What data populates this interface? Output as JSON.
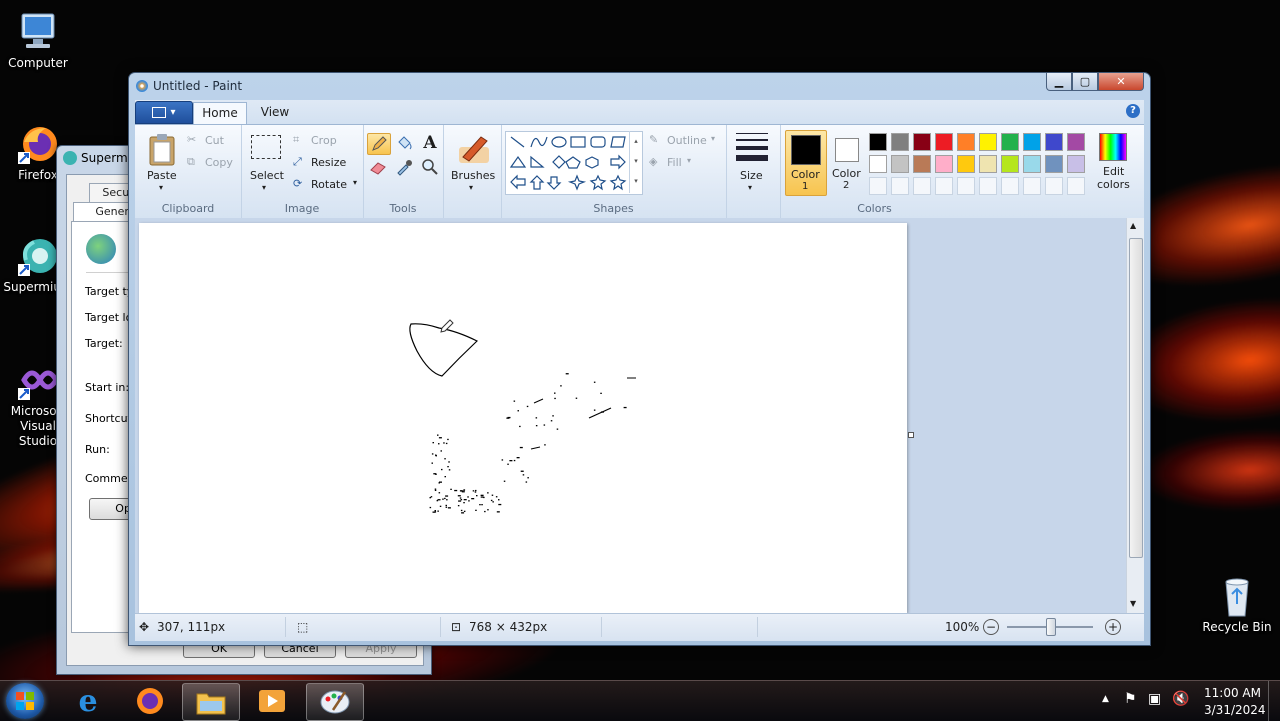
{
  "desktop": {
    "icons": [
      {
        "label": "Computer"
      },
      {
        "label": "Firefox"
      },
      {
        "label": "Supermium"
      },
      {
        "label": "Microsoft Visual Studio"
      },
      {
        "label": "Recycle Bin"
      }
    ]
  },
  "properties_dialog": {
    "title": "Supermium",
    "tabs": [
      "Security",
      "General"
    ],
    "fields": [
      "Target type:",
      "Target location:",
      "Target:",
      "Start in:",
      "Shortcut key:",
      "Run:",
      "Comment:"
    ],
    "open_button": "Open",
    "buttons": {
      "ok": "OK",
      "cancel": "Cancel",
      "apply": "Apply"
    }
  },
  "paint": {
    "title": "Untitled - Paint",
    "tabs": {
      "home": "Home",
      "view": "View"
    },
    "clipboard": {
      "label": "Clipboard",
      "paste": "Paste",
      "cut": "Cut",
      "copy": "Copy"
    },
    "image": {
      "label": "Image",
      "select": "Select",
      "crop": "Crop",
      "resize": "Resize",
      "rotate": "Rotate"
    },
    "tools": {
      "label": "Tools"
    },
    "brushes": {
      "label": "Brushes"
    },
    "shapes": {
      "label": "Shapes",
      "outline": "Outline",
      "fill": "Fill"
    },
    "size": {
      "label": "Size"
    },
    "color1": {
      "label": "Color",
      "num": "1",
      "value": "#000000"
    },
    "color2": {
      "label": "Color",
      "num": "2",
      "value": "#ffffff"
    },
    "colors": {
      "label": "Colors",
      "edit_label1": "Edit",
      "edit_label2": "colors",
      "row1": [
        "#000000",
        "#7f7f7f",
        "#880015",
        "#ed1c24",
        "#ff7f27",
        "#fff200",
        "#22b14c",
        "#00a2e8",
        "#3f48cc",
        "#a349a4"
      ],
      "row2": [
        "#ffffff",
        "#c3c3c3",
        "#b97a57",
        "#ffaec9",
        "#ffc90e",
        "#efe4b0",
        "#b5e61d",
        "#99d9ea",
        "#7092be",
        "#c8bfe7"
      ]
    },
    "status": {
      "cursor_pos": "307, 111px",
      "canvas_size": "768 × 432px",
      "zoom": "100%",
      "zoom_level": 0.5
    }
  },
  "taskbar": {
    "time": "11:00 AM",
    "date": "3/31/2024"
  }
}
